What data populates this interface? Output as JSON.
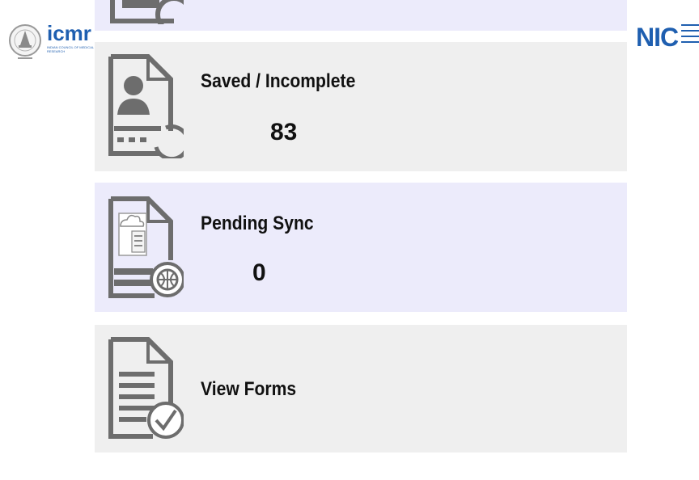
{
  "header": {
    "left_logo": {
      "name": "icmr-logo",
      "word": "icmr",
      "subtitle": "INDIAN COUNCIL OF MEDICAL RESEARCH"
    },
    "right_logo": {
      "name": "nic-logo",
      "word": "NIC"
    }
  },
  "cards": [
    {
      "id": "top-partial",
      "title": "",
      "count": ""
    },
    {
      "id": "saved-incomplete",
      "title": "Saved / Incomplete",
      "count": "83"
    },
    {
      "id": "pending-sync",
      "title": "Pending Sync",
      "count": "0"
    },
    {
      "id": "view-forms",
      "title": "View Forms",
      "count": ""
    }
  ],
  "colors": {
    "card_lavender": "#ecebfb",
    "card_gray": "#efefef",
    "icon_gray": "#6d6d6d",
    "brand_blue": "#1f5fb0"
  },
  "icons": [
    "user-document-icon",
    "cloud-document-icon",
    "globe-icon",
    "list-document-icon",
    "checkmark-icon"
  ]
}
